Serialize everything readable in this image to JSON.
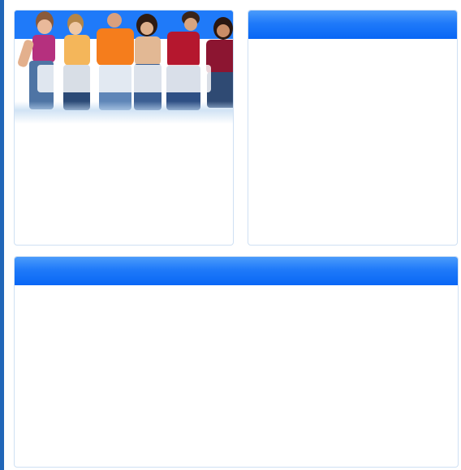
{
  "panels": {
    "top_left": {
      "title": ""
    },
    "top_right": {
      "title": ""
    },
    "bottom": {
      "title": ""
    }
  },
  "colors": {
    "header_gradient_top": "#4b9bfb",
    "header_gradient_bottom": "#0866f5",
    "panel_border": "#cfe0f3",
    "left_bar": "#2166b8"
  },
  "image": {
    "subject": "group-of-young-people-photo"
  }
}
